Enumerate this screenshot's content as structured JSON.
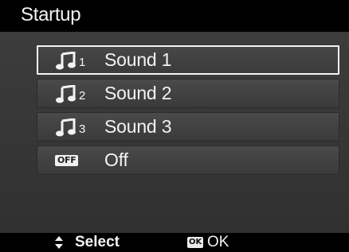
{
  "title": "Startup",
  "menu": {
    "items": [
      {
        "icon": "music-note-icon",
        "num": "1",
        "label": "Sound 1",
        "selected": true
      },
      {
        "icon": "music-note-icon",
        "num": "2",
        "label": "Sound 2",
        "selected": false
      },
      {
        "icon": "music-note-icon",
        "num": "3",
        "label": "Sound 3",
        "selected": false
      },
      {
        "icon": "off-icon",
        "badge": "OFF",
        "label": "Off",
        "selected": false
      }
    ]
  },
  "hints": {
    "select_icon": "up-down-arrows-icon",
    "select_label": "Select",
    "ok_badge": "OK",
    "ok_label": "OK"
  },
  "colors": {
    "background": "#3a3a3a",
    "bar": "#000000",
    "selection_border": "#f4f4f4",
    "text": "#f3f3f3"
  }
}
